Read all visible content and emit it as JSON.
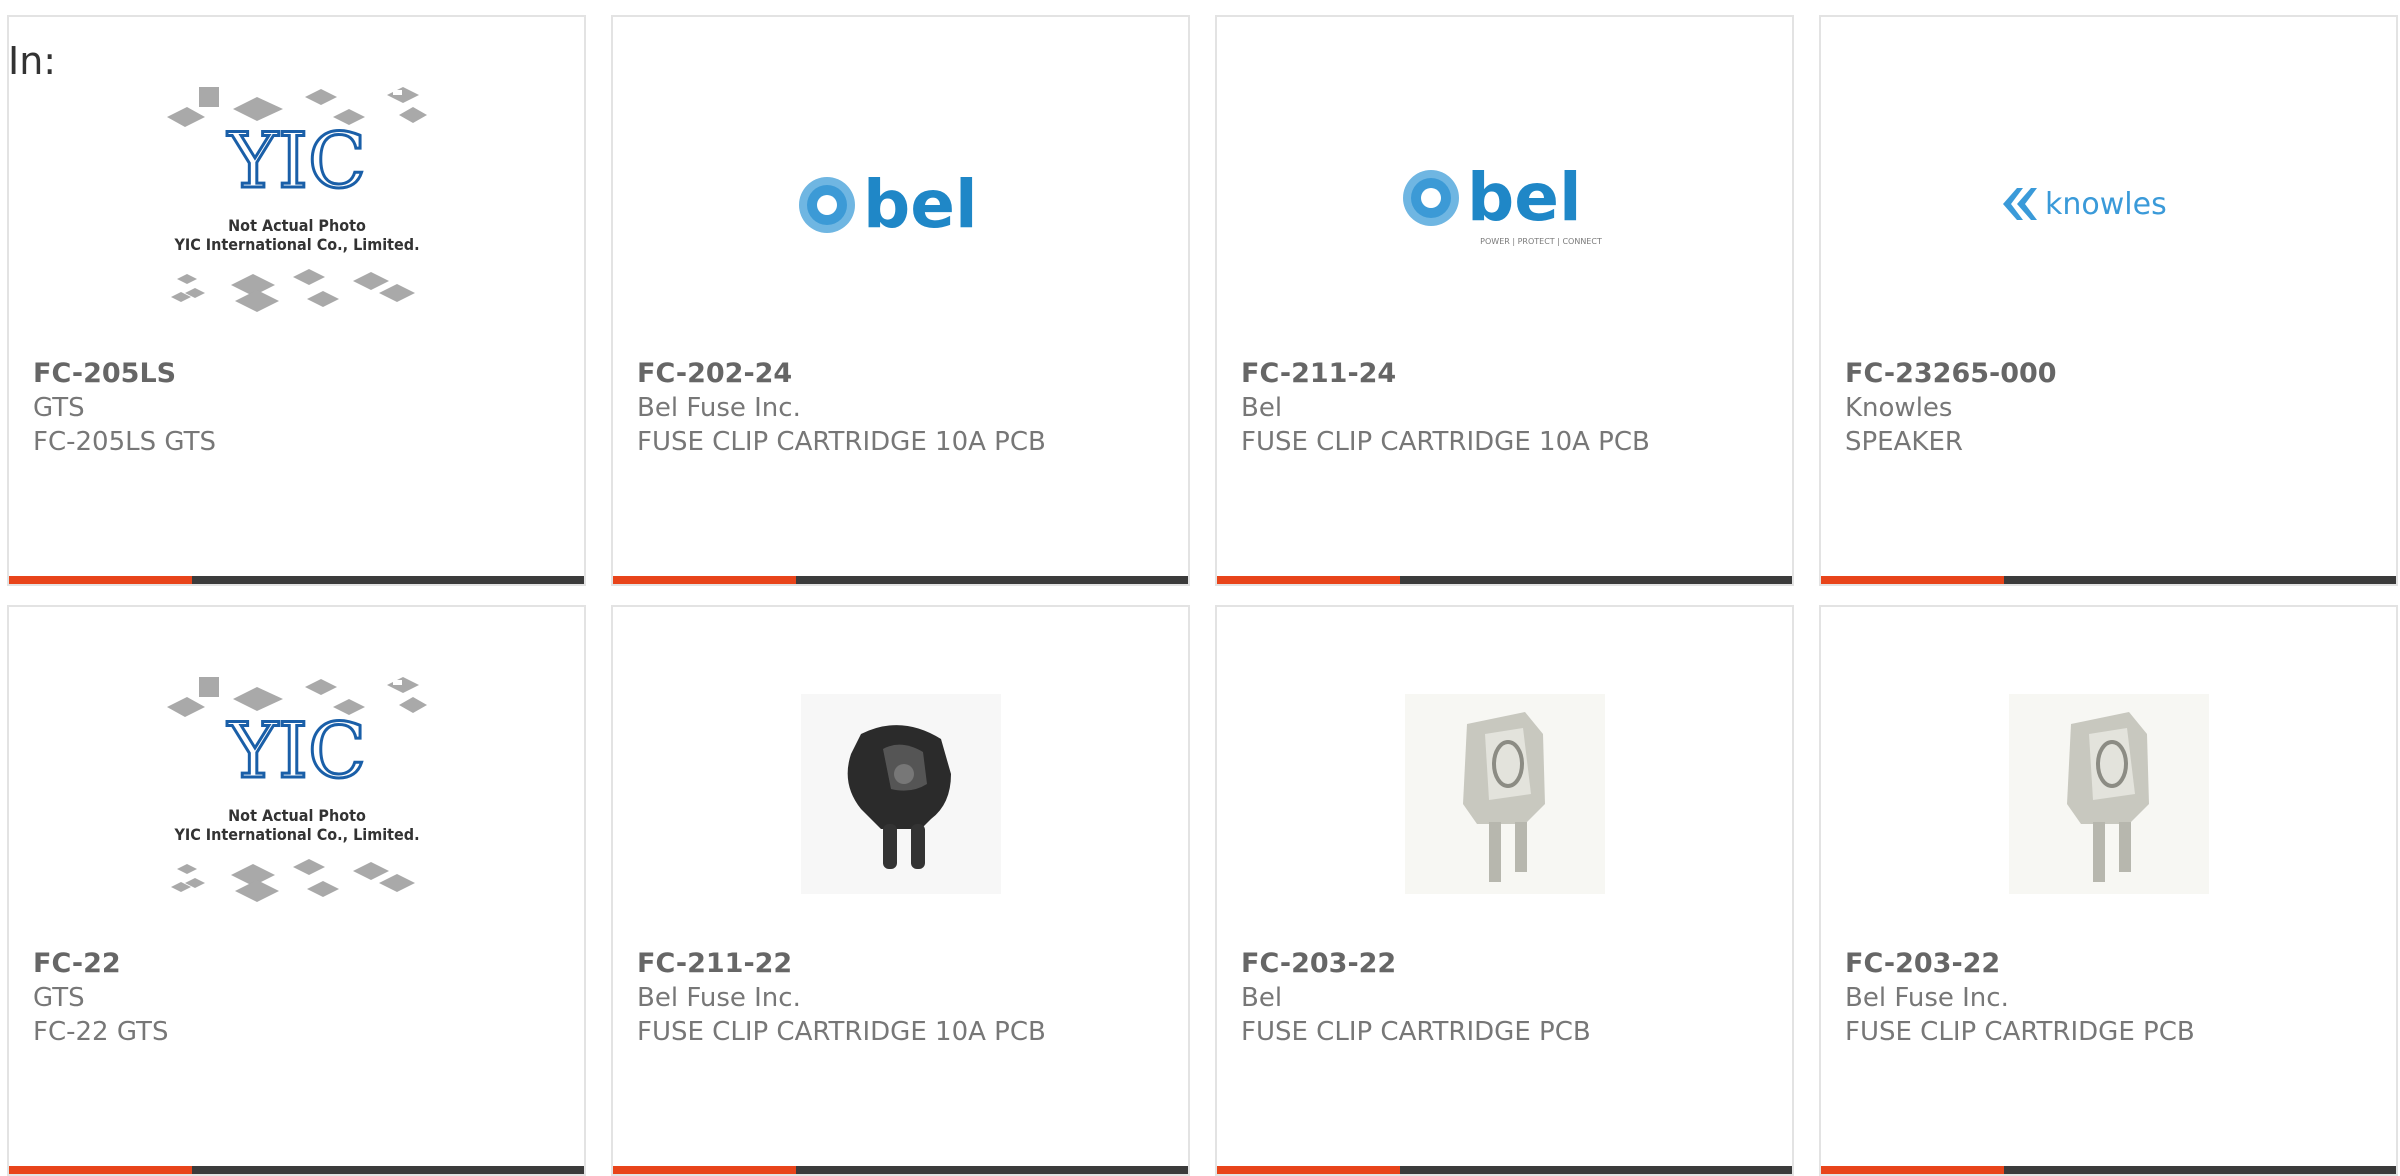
{
  "header": {
    "in_label": "In:"
  },
  "colors": {
    "accent": "#e8441a",
    "bar_dark": "#3b3b3b",
    "bel_blue": "#1f87c7",
    "knowles_blue": "#3a9ad9",
    "yic_blue": "#1a5fa8"
  },
  "products": [
    {
      "part_number": "FC-205LS",
      "manufacturer": "GTS",
      "description": "FC-205LS GTS",
      "image": "yic-placeholder",
      "image_text": [
        "Not Actual Photo",
        "YIC International Co., Limited."
      ]
    },
    {
      "part_number": "FC-202-24",
      "manufacturer": "Bel Fuse Inc.",
      "description": "FUSE CLIP CARTRIDGE 10A PCB",
      "image": "bel-logo",
      "logo_text": "bel"
    },
    {
      "part_number": "FC-211-24",
      "manufacturer": "Bel",
      "description": "FUSE CLIP CARTRIDGE 10A PCB",
      "image": "bel-logo-tagline",
      "logo_text": "bel",
      "tagline": "POWER | PROTECT | CONNECT"
    },
    {
      "part_number": "FC-23265-000",
      "manufacturer": "Knowles",
      "description": "SPEAKER",
      "image": "knowles-logo",
      "logo_text": "knowles"
    },
    {
      "part_number": "FC-22",
      "manufacturer": "GTS",
      "description": "FC-22 GTS",
      "image": "yic-placeholder",
      "image_text": [
        "Not Actual Photo",
        "YIC International Co., Limited."
      ]
    },
    {
      "part_number": "FC-211-22",
      "manufacturer": "Bel Fuse Inc.",
      "description": "FUSE CLIP CARTRIDGE 10A PCB",
      "image": "black-fuse-clip"
    },
    {
      "part_number": "FC-203-22",
      "manufacturer": "Bel",
      "description": "FUSE CLIP CARTRIDGE PCB",
      "image": "silver-fuse-clip"
    },
    {
      "part_number": "FC-203-22",
      "manufacturer": "Bel Fuse Inc.",
      "description": "FUSE CLIP CARTRIDGE PCB",
      "image": "silver-fuse-clip"
    }
  ]
}
